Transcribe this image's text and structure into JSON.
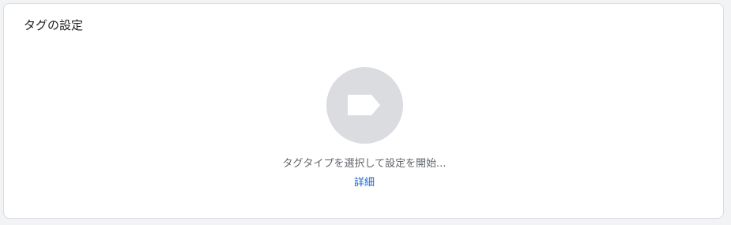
{
  "card": {
    "title": "タグの設定",
    "placeholder_icon": "tag-icon",
    "hint": "タグタイプを選択して設定を開始...",
    "details_link": "詳細"
  },
  "colors": {
    "page_background": "#f1f3f4",
    "card_background": "#ffffff",
    "icon_circle": "#dadce0",
    "icon_fill": "#ffffff",
    "hint_text": "#5f6368",
    "link": "#1967d2"
  }
}
